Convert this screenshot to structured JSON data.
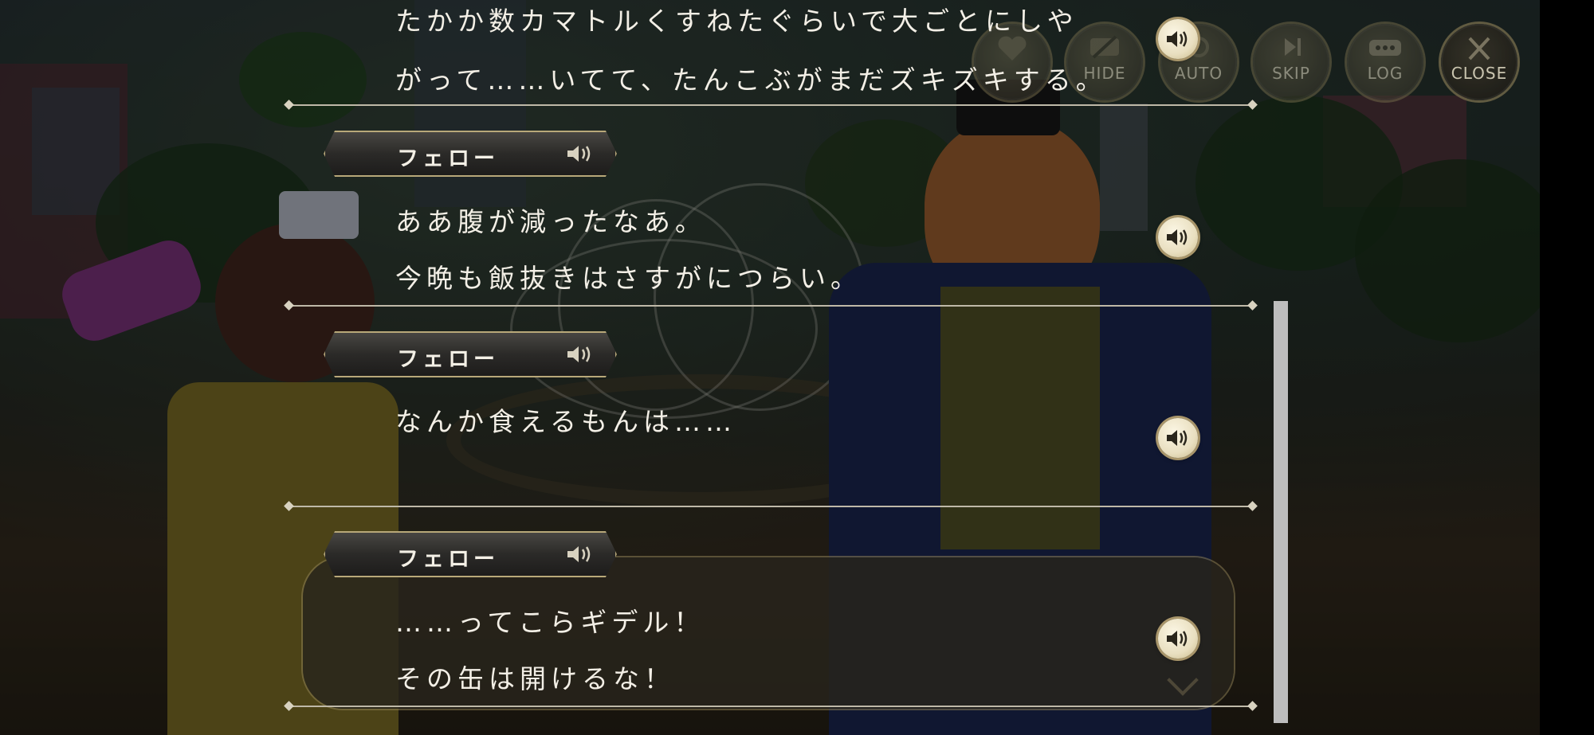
{
  "toolbar": {
    "favorite_label": "",
    "hide_label": "HIDE",
    "auto_label": "AUTO",
    "skip_label": "SKIP",
    "log_label": "LOG",
    "close_label": "CLOSE"
  },
  "log": {
    "partial_entry": {
      "line1": "たかか数カマトルくすねたぐらいで大ごとにしや",
      "line2": "がって……いてて、たんこぶがまだズキズキする。"
    },
    "entries": [
      {
        "speaker": "フェロー",
        "lines": [
          "ああ腹が減ったなあ。",
          "今晩も飯抜きはさすがにつらい。"
        ]
      },
      {
        "speaker": "フェロー",
        "lines": [
          "なんか食えるもんは……"
        ]
      },
      {
        "speaker": "フェロー",
        "lines": [
          "……ってこらギデル！",
          "その缶は開けるな！"
        ]
      }
    ]
  },
  "icons": {
    "voice": "speaker-icon",
    "favorite": "heart-icon",
    "hide": "hide-icon",
    "auto": "auto-icon",
    "skip": "skip-icon",
    "log": "log-icon",
    "close": "close-icon"
  },
  "colors": {
    "text": "#f3efe6",
    "accent_gold": "#b8a879",
    "namebar_dark": "#2b2a28"
  }
}
